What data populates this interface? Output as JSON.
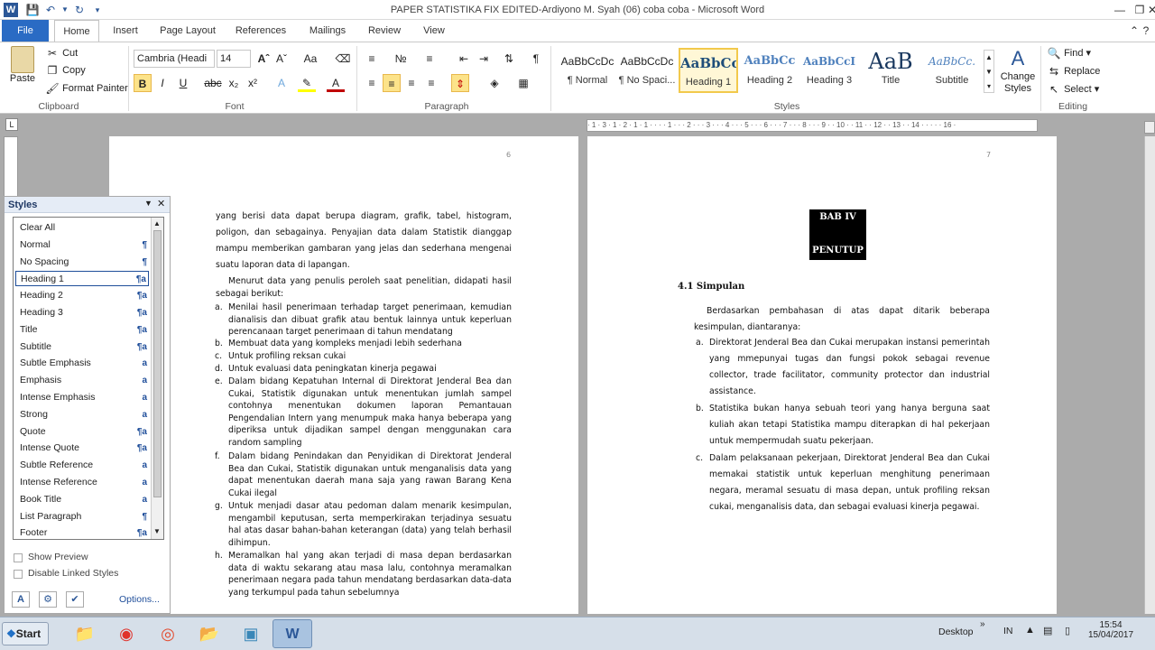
{
  "window": {
    "title": "PAPER STATISTIKA FIX EDITED-Ardiyono M. Syah (06) coba coba  -  Microsoft Word"
  },
  "tabs": [
    "File",
    "Home",
    "Insert",
    "Page Layout",
    "References",
    "Mailings",
    "Review",
    "View"
  ],
  "active_tab": "Home",
  "clipboard": {
    "paste": "Paste",
    "cut": "Cut",
    "copy": "Copy",
    "format_painter": "Format Painter",
    "group": "Clipboard"
  },
  "font": {
    "name": "Cambria (Headi",
    "size": "14",
    "group": "Font"
  },
  "paragraph": {
    "group": "Paragraph"
  },
  "styles": {
    "group": "Styles",
    "gallery": [
      {
        "preview": "AaBbCcDc",
        "name": "¶ Normal"
      },
      {
        "preview": "AaBbCcDc",
        "name": "¶ No Spaci..."
      },
      {
        "preview": "AaBbCc",
        "name": "Heading 1"
      },
      {
        "preview": "AaBbCc",
        "name": "Heading 2"
      },
      {
        "preview": "AaBbCcI",
        "name": "Heading 3"
      },
      {
        "preview": "AaB",
        "name": "Title"
      },
      {
        "preview": "AaBbCc.",
        "name": "Subtitle"
      }
    ],
    "change_styles": "Change Styles"
  },
  "editing": {
    "find": "Find",
    "replace": "Replace",
    "select": "Select",
    "group": "Editing"
  },
  "ruler": {
    "text": "· 1 · 3 · 1 · 2 · 1 · 1 · · · · 1 · · · 2 · · · 3 · · · 4 · · · 5 · · · 6 · · · 7 · · · 8 · · · 9 · · 10 · · 11 · · 12 · · 13 · · 14 · · · · · 16 ·"
  },
  "pane": {
    "title": "Styles",
    "items": [
      {
        "label": "Clear All",
        "glyph": ""
      },
      {
        "label": "Normal",
        "glyph": "¶"
      },
      {
        "label": "No Spacing",
        "glyph": "¶"
      },
      {
        "label": "Heading 1",
        "glyph": "¶a"
      },
      {
        "label": "Heading 2",
        "glyph": "¶a"
      },
      {
        "label": "Heading 3",
        "glyph": "¶a"
      },
      {
        "label": "Title",
        "glyph": "¶a"
      },
      {
        "label": "Subtitle",
        "glyph": "¶a"
      },
      {
        "label": "Subtle Emphasis",
        "glyph": "a"
      },
      {
        "label": "Emphasis",
        "glyph": "a"
      },
      {
        "label": "Intense Emphasis",
        "glyph": "a"
      },
      {
        "label": "Strong",
        "glyph": "a"
      },
      {
        "label": "Quote",
        "glyph": "¶a"
      },
      {
        "label": "Intense Quote",
        "glyph": "¶a"
      },
      {
        "label": "Subtle Reference",
        "glyph": "a"
      },
      {
        "label": "Intense Reference",
        "glyph": "a"
      },
      {
        "label": "Book Title",
        "glyph": "a"
      },
      {
        "label": "List Paragraph",
        "glyph": "¶"
      },
      {
        "label": "Footer",
        "glyph": "¶a"
      }
    ],
    "show_preview": "Show Preview",
    "disable_linked": "Disable Linked Styles",
    "options": "Options..."
  },
  "page6": {
    "number": "6",
    "para1": "yang berisi data dapat berupa diagram, grafik, tabel, histogram, poligon, dan sebagainya. Penyajian data dalam Statistik dianggap mampu memberikan gambaran yang jelas dan sederhana mengenai suatu laporan data di lapangan.",
    "para2": "Menurut data yang penulis peroleh saat penelitian, didapati hasil sebagai berikut:",
    "items": [
      {
        "m": "a.",
        "t": "Menilai hasil penerimaan terhadap target penerimaan, kemudian dianalisis dan dibuat grafik atau bentuk lainnya untuk keperluan perencanaan target penerimaan di tahun mendatang"
      },
      {
        "m": "b.",
        "t": "Membuat data yang kompleks menjadi lebih sederhana"
      },
      {
        "m": "c.",
        "t": "Untuk profiling reksan cukai"
      },
      {
        "m": "d.",
        "t": "Untuk evaluasi data peningkatan kinerja pegawai"
      },
      {
        "m": "e.",
        "t": "Dalam bidang Kepatuhan Internal di Direktorat Jenderal Bea dan Cukai, Statistik digunakan untuk menentukan jumlah sampel contohnya menentukan dokumen laporan Pemantauan Pengendalian Intern yang menumpuk maka hanya beberapa yang diperiksa untuk dijadikan sampel dengan menggunakan cara random sampling"
      },
      {
        "m": "f.",
        "t": "Dalam bidang Penindakan dan Penyidikan di Direktorat Jenderal Bea dan Cukai, Statistik digunakan untuk menganalisis data yang dapat menentukan daerah mana saja yang rawan Barang Kena Cukai ilegal"
      },
      {
        "m": "g.",
        "t": "Untuk menjadi dasar atau pedoman dalam menarik kesimpulan, mengambil keputusan, serta memperkirakan terjadinya sesuatu hal atas dasar bahan-bahan keterangan (data) yang telah berhasil dihimpun."
      },
      {
        "m": "h.",
        "t": "Meramalkan hal yang akan terjadi di masa depan berdasarkan data di waktu sekarang atau masa lalu, contohnya meramalkan penerimaan negara pada tahun mendatang berdasarkan data-data yang terkumpul pada tahun sebelumnya"
      }
    ]
  },
  "page7": {
    "number": "7",
    "chapter": "BAB IV",
    "chapter_title": "PENUTUP",
    "section": "4.1 Simpulan",
    "intro": "Berdasarkan pembahasan di atas dapat ditarik beberapa kesimpulan, diantaranya:",
    "items": [
      {
        "m": "a.",
        "t": "Direktorat Jenderal Bea dan Cukai merupakan instansi pemerintah yang mmepunyai tugas dan fungsi pokok sebagai revenue collector, trade facilitator, community protector dan industrial assistance."
      },
      {
        "m": "b.",
        "t": "Statistika bukan hanya sebuah teori yang hanya berguna saat kuliah akan tetapi Statistika mampu diterapkan di hal pekerjaan untuk mempermudah suatu pekerjaan."
      },
      {
        "m": "c.",
        "t": "Dalam pelaksanaan pekerjaan, Direktorat Jenderal Bea dan Cukai memakai statistik untuk keperluan menghitung penerimaan negara, meramal sesuatu di masa depan, untuk profiling reksan cukai, menganalisis data, dan sebagai evaluasi kinerja pegawai."
      }
    ]
  },
  "taskbar": {
    "start": "Start",
    "desktop": "Desktop",
    "lang": "IN",
    "time": "15:54",
    "date": "15/04/2017"
  }
}
